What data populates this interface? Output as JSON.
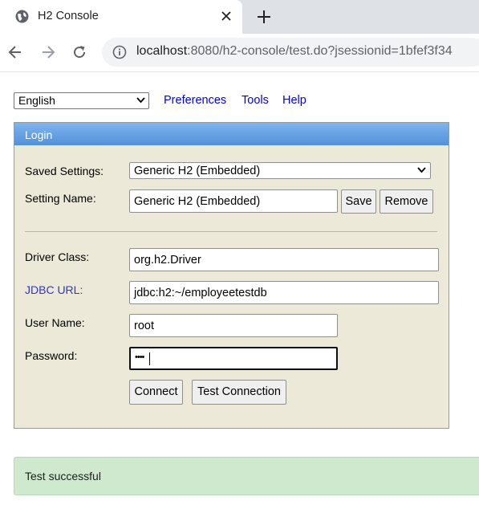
{
  "browser": {
    "tab_title": "H2 Console",
    "url_host": "localhost",
    "url_rest": ":8080/h2-console/test.do?jsessionid=1bfef3f34"
  },
  "topbar": {
    "language": "English",
    "links": [
      "Preferences",
      "Tools",
      "Help"
    ]
  },
  "login": {
    "header": "Login",
    "saved_settings_label": "Saved Settings:",
    "saved_settings_value": "Generic H2 (Embedded)",
    "setting_name_label": "Setting Name:",
    "setting_name_value": "Generic H2 (Embedded)",
    "save_label": "Save",
    "remove_label": "Remove",
    "driver_class_label": "Driver Class:",
    "driver_class_value": "org.h2.Driver",
    "jdbc_url_label": "JDBC URL:",
    "jdbc_url_value": "jdbc:h2:~/employeetestdb",
    "user_name_label": "User Name:",
    "user_name_value": "root",
    "password_label": "Password:",
    "password_value": "••••",
    "connect_label": "Connect",
    "test_connection_label": "Test Connection"
  },
  "status": {
    "message": "Test successful"
  },
  "colors": {
    "panel_bg": "#ece9d8",
    "header_accent": "#5290d9",
    "link": "#0000ee",
    "success_bg": "#cfe9cf"
  }
}
